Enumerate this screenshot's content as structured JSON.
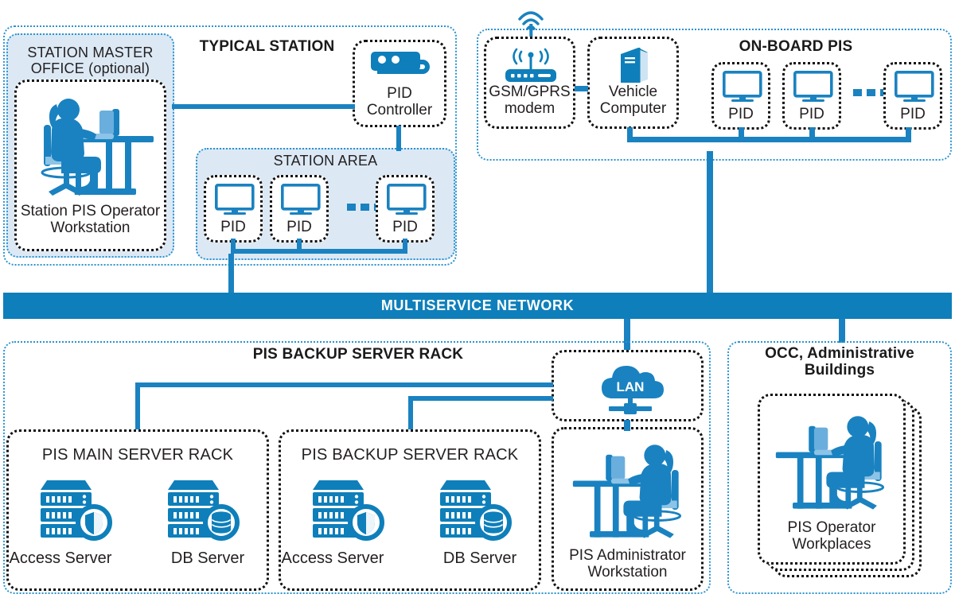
{
  "diagram": {
    "title_typical_station": "TYPICAL STATION",
    "title_onboard_pis": "ON-BOARD PIS",
    "title_backup_rack_zone": "PIS BACKUP SERVER RACK",
    "title_occ": "OCC, Administrative\nBuildings",
    "network_bus_label": "MULTISERVICE NETWORK"
  },
  "typical_station": {
    "station_master_office": {
      "title": "STATION MASTER\nOFFICE (optional)",
      "workstation_label": "Station PIS Operator\nWorkstation",
      "icon": "operator-workstation-icon"
    },
    "pid_controller": {
      "label": "PID\nController",
      "icon": "pid-controller-icon"
    },
    "station_area": {
      "title": "STATION AREA",
      "displays": [
        {
          "label": "PID",
          "icon": "monitor-icon"
        },
        {
          "label": "PID",
          "icon": "monitor-icon"
        },
        {
          "label": "PID",
          "icon": "monitor-icon"
        }
      ],
      "ellipsis": "…"
    }
  },
  "onboard_pis": {
    "title": "ON-BOARD PIS",
    "modem": {
      "label": "GSM/GPRS\nmodem",
      "icon": "wifi-router-icon",
      "antenna_icon": "antenna-signal-icon"
    },
    "vehicle_computer": {
      "label": "Vehicle\nComputer",
      "icon": "computer-tower-icon"
    },
    "displays": [
      {
        "label": "PID",
        "icon": "monitor-icon"
      },
      {
        "label": "PID",
        "icon": "monitor-icon"
      },
      {
        "label": "PID",
        "icon": "monitor-icon"
      }
    ]
  },
  "backup_zone": {
    "title": "PIS BACKUP SERVER RACK",
    "racks": [
      {
        "title": "PIS MAIN SERVER RACK",
        "servers": [
          {
            "label": "Access Server",
            "icon": "server-shield-icon"
          },
          {
            "label": "DB Server",
            "icon": "server-database-icon"
          }
        ]
      },
      {
        "title": "PIS BACKUP SERVER RACK",
        "servers": [
          {
            "label": "Access Server",
            "icon": "server-shield-icon"
          },
          {
            "label": "DB Server",
            "icon": "server-database-icon"
          }
        ]
      }
    ],
    "lan": {
      "label": "LAN",
      "icon": "cloud-lan-icon"
    },
    "admin_workstation": {
      "label": "PIS Administrator\nWorkstation",
      "icon": "operator-workstation-icon"
    }
  },
  "occ": {
    "title": "OCC, Administrative\nBuildings",
    "operator_workplaces": {
      "label": "PIS Operator\nWorkplaces",
      "icon": "operator-workstation-icon"
    }
  },
  "colors": {
    "primary_blue": "#0e7fba",
    "line_blue": "#1a82c0",
    "light_blue_fill": "#dce9f5",
    "zone_border_blue": "#2b93d1",
    "dash_black": "#111111",
    "text_dark": "#231f20",
    "white": "#ffffff"
  }
}
